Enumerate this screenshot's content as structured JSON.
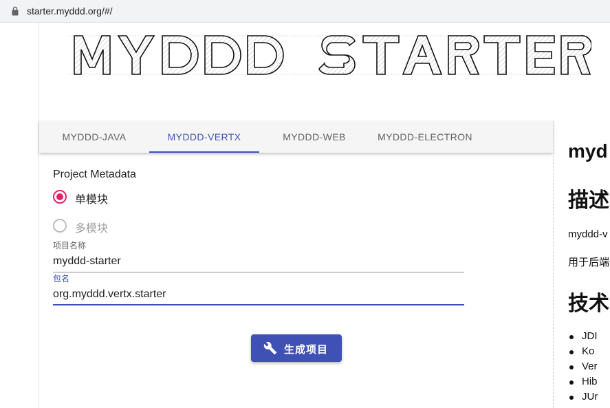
{
  "browser": {
    "url": "starter.myddd.org/#/"
  },
  "banner": {
    "text": "MYDDD STARTER"
  },
  "tabs": [
    {
      "label": "MYDDD-JAVA"
    },
    {
      "label": "MYDDD-VERTX",
      "active": true
    },
    {
      "label": "MYDDD-WEB"
    },
    {
      "label": "MYDDD-ELECTRON"
    }
  ],
  "form": {
    "section_title": "Project Metadata",
    "radios": [
      {
        "label": "单模块",
        "checked": true
      },
      {
        "label": "多模块",
        "checked": false
      }
    ],
    "project_name": {
      "label": "项目名称",
      "value": "myddd-starter"
    },
    "package_name": {
      "label": "包名",
      "value": "org.myddd.vertx.starter"
    },
    "generate_button": "生成项目"
  },
  "readme": {
    "title": "myd",
    "h_desc": "描述",
    "p1": "myddd-v",
    "p2": "用于后端",
    "h_tech": "技术",
    "list": [
      "JDI",
      "Ko",
      "Ver",
      "Hib",
      "JUr"
    ]
  },
  "colors": {
    "accent": "#3f51b5",
    "radio": "#e91e63"
  }
}
